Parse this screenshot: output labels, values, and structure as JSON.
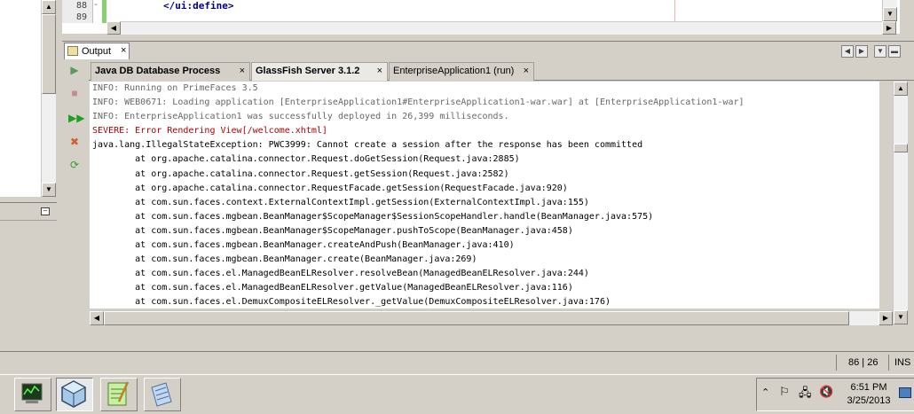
{
  "editor": {
    "line_numbers": [
      "88",
      "89"
    ],
    "fold_marker": "-",
    "code_line": "</ui:define>"
  },
  "output_window": {
    "tab_label": "Output",
    "close_glyph": "×",
    "sub_tabs": [
      {
        "label": "Java DB Database Process",
        "close": "×"
      },
      {
        "label": "GlassFish Server 3.1.2",
        "close": "×"
      },
      {
        "label": "EnterpriseApplication1 (run)",
        "close": "×"
      }
    ],
    "console_lines": [
      {
        "kind": "info",
        "text": "INFO: Running on PrimeFaces 3.5"
      },
      {
        "kind": "info",
        "text": "INFO: WEB0671: Loading application [EnterpriseApplication1#EnterpriseApplication1-war.war] at [EnterpriseApplication1-war]"
      },
      {
        "kind": "info",
        "text": "INFO: EnterpriseApplication1 was successfully deployed in 26,399 milliseconds."
      },
      {
        "kind": "severe",
        "text": "SEVERE: Error Rendering View[/welcome.xhtml]"
      },
      {
        "kind": "plain",
        "text": "java.lang.IllegalStateException: PWC3999: Cannot create a session after the response has been committed"
      },
      {
        "kind": "plain",
        "text": "\tat org.apache.catalina.connector.Request.doGetSession(Request.java:2885)"
      },
      {
        "kind": "plain",
        "text": "\tat org.apache.catalina.connector.Request.getSession(Request.java:2582)"
      },
      {
        "kind": "plain",
        "text": "\tat org.apache.catalina.connector.RequestFacade.getSession(RequestFacade.java:920)"
      },
      {
        "kind": "plain",
        "text": "\tat com.sun.faces.context.ExternalContextImpl.getSession(ExternalContextImpl.java:155)"
      },
      {
        "kind": "plain",
        "text": "\tat com.sun.faces.mgbean.BeanManager$ScopeManager$SessionScopeHandler.handle(BeanManager.java:575)"
      },
      {
        "kind": "plain",
        "text": "\tat com.sun.faces.mgbean.BeanManager$ScopeManager.pushToScope(BeanManager.java:458)"
      },
      {
        "kind": "plain",
        "text": "\tat com.sun.faces.mgbean.BeanManager.createAndPush(BeanManager.java:410)"
      },
      {
        "kind": "plain",
        "text": "\tat com.sun.faces.mgbean.BeanManager.create(BeanManager.java:269)"
      },
      {
        "kind": "plain",
        "text": "\tat com.sun.faces.el.ManagedBeanELResolver.resolveBean(ManagedBeanELResolver.java:244)"
      },
      {
        "kind": "plain",
        "text": "\tat com.sun.faces.el.ManagedBeanELResolver.getValue(ManagedBeanELResolver.java:116)"
      },
      {
        "kind": "plain",
        "text": "\tat com.sun.faces.el.DemuxCompositeELResolver._getValue(DemuxCompositeELResolver.java:176)"
      }
    ],
    "toolbar_icons": [
      "rerun-icon",
      "stop-icon",
      "rerun-fast-icon",
      "clear-icon",
      "refresh-icon"
    ]
  },
  "status_bar": {
    "position": "86 | 26",
    "mode": "INS"
  },
  "taskbar": {
    "buttons": [
      "server-manager-icon",
      "netbeans-icon",
      "notepad-plus-icon",
      "wordpad-icon"
    ],
    "clock_time": "6:51 PM",
    "clock_date": "3/25/2013"
  },
  "colors": {
    "info_text": "#686868",
    "severe_text": "#b00000",
    "code_tag": "#000080"
  }
}
